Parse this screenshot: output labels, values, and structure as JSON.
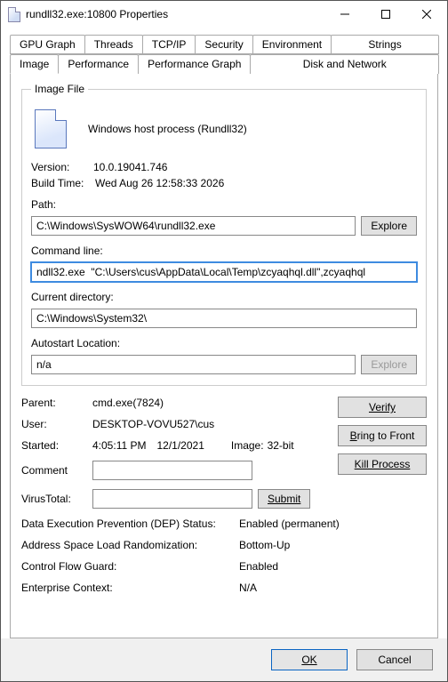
{
  "window": {
    "title": "rundll32.exe:10800 Properties"
  },
  "tabs_row1": [
    "GPU Graph",
    "Threads",
    "TCP/IP",
    "Security",
    "Environment",
    "Strings"
  ],
  "tabs_row2": [
    "Image",
    "Performance",
    "Performance Graph",
    "Disk and Network"
  ],
  "image_file": {
    "legend": "Image File",
    "description": "Windows host process (Rundll32)",
    "version_label": "Version:",
    "version": "10.0.19041.746",
    "build_time_label": "Build Time:",
    "build_time": "Wed Aug 26 12:58:33 2026",
    "path_label": "Path:",
    "path": "C:\\Windows\\SysWOW64\\rundll32.exe",
    "explore1": "Explore",
    "cmdline_label": "Command line:",
    "cmdline": "ndll32.exe  \"C:\\Users\\cus\\AppData\\Local\\Temp\\zcyaqhql.dll\",zcyaqhql",
    "curdir_label": "Current directory:",
    "curdir": "C:\\Windows\\System32\\",
    "autostart_label": "Autostart Location:",
    "autostart": "n/a",
    "explore2": "Explore"
  },
  "details": {
    "parent_label": "Parent:",
    "parent": "cmd.exe(7824)",
    "user_label": "User:",
    "user": "DESKTOP-VOVU527\\cus",
    "started_label": "Started:",
    "started_time": "4:05:11 PM",
    "started_date": "12/1/2021",
    "image_label": "Image:",
    "image_bits": "32-bit",
    "comment_label": "Comment",
    "virustotal_label": "VirusTotal:",
    "submit": "Submit",
    "dep_label": "Data Execution Prevention (DEP) Status:",
    "dep_value": "Enabled (permanent)",
    "aslr_label": "Address Space Load Randomization:",
    "aslr_value": "Bottom-Up",
    "cfg_label": "Control Flow Guard:",
    "cfg_value": "Enabled",
    "ent_label": "Enterprise Context:",
    "ent_value": "N/A"
  },
  "actions": {
    "verify": "Verify",
    "bring_front": "Bring to Front",
    "kill": "Kill Process"
  },
  "footer": {
    "ok": "OK",
    "cancel": "Cancel"
  }
}
